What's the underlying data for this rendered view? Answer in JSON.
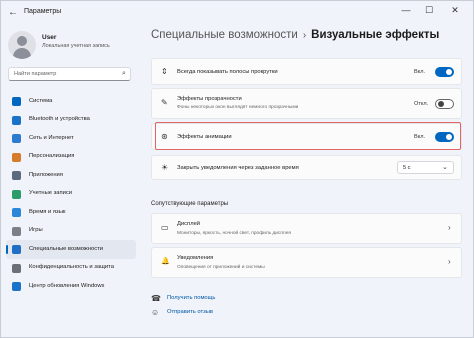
{
  "window": {
    "title": "Параметры",
    "back_glyph": "←",
    "controls": {
      "minimize": "—",
      "maximize": "☐",
      "close": "✕"
    }
  },
  "user": {
    "name": "User",
    "account": "Локальная учетная запись"
  },
  "search": {
    "placeholder": "Найти параметр",
    "icon": "search-icon",
    "glyph": "⌕"
  },
  "sidebar": {
    "items": [
      {
        "label": "Система",
        "icon": "monitor-icon",
        "color": "#0067c0",
        "active": false
      },
      {
        "label": "Bluetooth и устройства",
        "icon": "bluetooth-icon",
        "color": "#1a73c9",
        "active": false
      },
      {
        "label": "Сеть и Интернет",
        "icon": "wifi-icon",
        "color": "#2d7bd1",
        "active": false
      },
      {
        "label": "Персонализация",
        "icon": "brush-icon",
        "color": "#d67b2a",
        "active": false
      },
      {
        "label": "Приложения",
        "icon": "apps-icon",
        "color": "#5b6b7d",
        "active": false
      },
      {
        "label": "Учетные записи",
        "icon": "person-icon",
        "color": "#2a9d6a",
        "active": false
      },
      {
        "label": "Время и язык",
        "icon": "globe-clock-icon",
        "color": "#2b88d8",
        "active": false
      },
      {
        "label": "Игры",
        "icon": "gamepad-icon",
        "color": "#7a7f88",
        "active": false
      },
      {
        "label": "Специальные возможности",
        "icon": "accessibility-icon",
        "color": "#1f6fc4",
        "active": true
      },
      {
        "label": "Конфиденциальность и защита",
        "icon": "shield-icon",
        "color": "#6a6f78",
        "active": false
      },
      {
        "label": "Центр обновления Windows",
        "icon": "update-icon",
        "color": "#1a73c9",
        "active": false
      }
    ]
  },
  "breadcrumb": {
    "parent": "Специальные возможности",
    "separator": "›",
    "current": "Визуальные эффекты"
  },
  "settings": {
    "scrollbars": {
      "label": "Всегда показывать полосы прокрутки",
      "state": "Вкл.",
      "on": true,
      "icon": "scrollbar-icon",
      "glyph": "⇕"
    },
    "transparency": {
      "label": "Эффекты прозрачности",
      "desc": "Фоны некоторых окон выглядят немного прозрачными",
      "state": "Откл.",
      "on": false,
      "icon": "transparency-icon",
      "glyph": "✎"
    },
    "animation": {
      "label": "Эффекты анимации",
      "state": "Вкл.",
      "on": true,
      "icon": "animation-icon",
      "glyph": "⊛"
    },
    "notifications": {
      "label": "Закрыть уведомления через заданное время",
      "value": "5 с",
      "icon": "sun-icon",
      "glyph": "☀",
      "chevron": "⌄"
    }
  },
  "related": {
    "title": "Сопутствующие параметры",
    "display": {
      "label": "Дисплей",
      "desc": "Мониторы, яркость, ночной свет, профиль дисплея",
      "icon": "display-icon",
      "glyph": "▭",
      "chevron": "›"
    },
    "notifications": {
      "label": "Уведомления",
      "desc": "Оповещения от приложений и системы",
      "icon": "bell-icon",
      "glyph": "🔔",
      "chevron": "›"
    }
  },
  "help": {
    "get_help": {
      "label": "Получить помощь",
      "icon": "help-icon",
      "glyph": "☎"
    },
    "feedback": {
      "label": "Отправить отзыв",
      "icon": "feedback-icon",
      "glyph": "☺"
    }
  },
  "colors": {
    "accent": "#0067c0",
    "highlight_border": "#e06666"
  }
}
